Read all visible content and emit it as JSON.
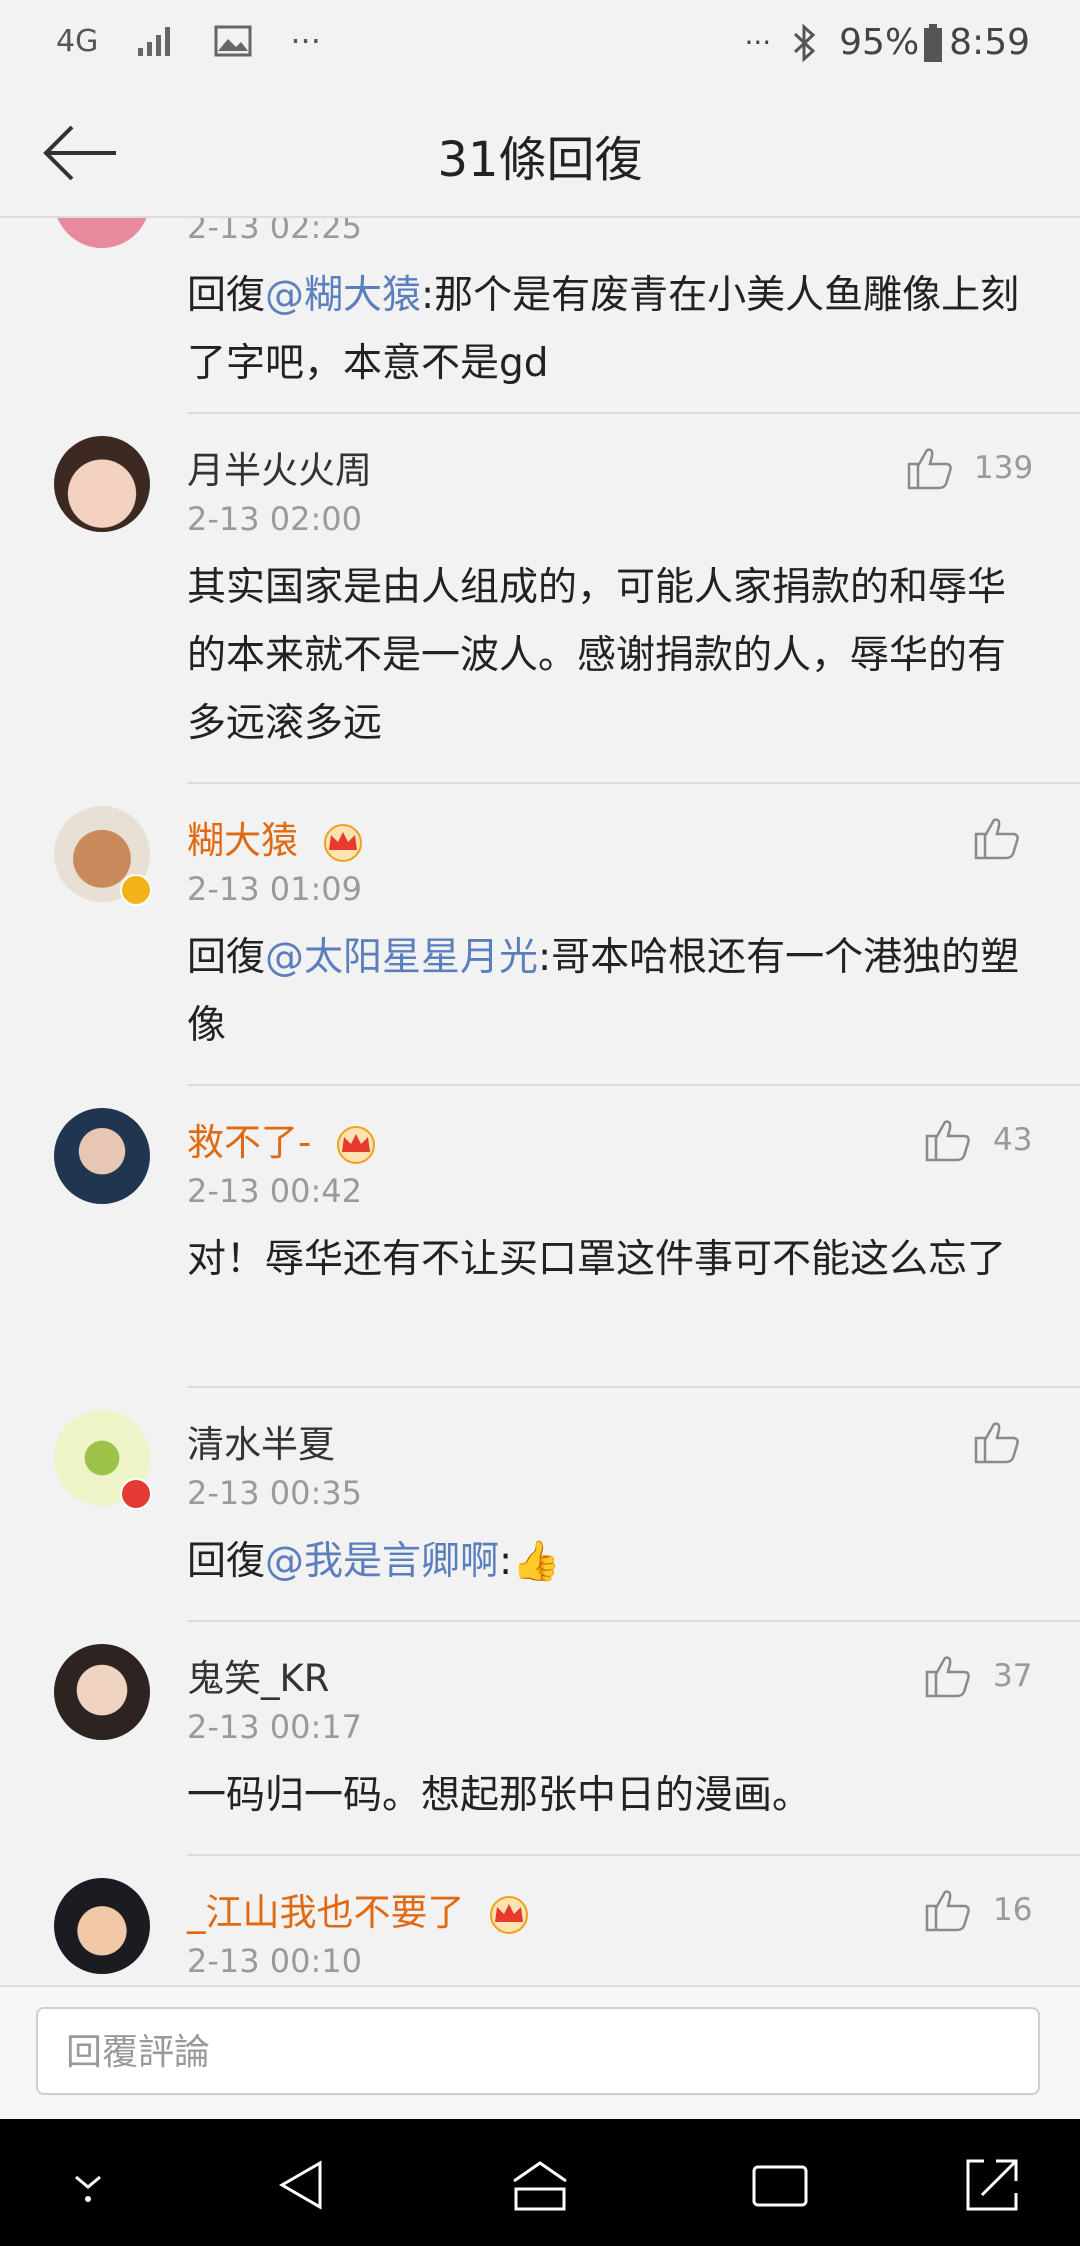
{
  "status": {
    "network": "4G",
    "more": "···",
    "dots_right": "···",
    "battery": "95%",
    "time": "8:59"
  },
  "header": {
    "title": "31條回復"
  },
  "comments": [
    {
      "name": "",
      "time": "2-13 02:25",
      "prefix": "回復",
      "mention": "@糊大猿",
      "text": ":那个是有废青在小美人鱼雕像上刻了字吧，本意不是gd",
      "likes": ""
    },
    {
      "name": "月半火火周",
      "time": "2-13 02:00",
      "prefix": "",
      "mention": "",
      "text": "其实国家是由人组成的，可能人家捐款的和辱华的本来就不是一波人。感谢捐款的人，辱华的有多远滚多远",
      "likes": "139"
    },
    {
      "name": "糊大猿",
      "time": "2-13 01:09",
      "prefix": "回復",
      "mention": "@太阳星星月光",
      "text": ":哥本哈根还有一个港独的塑像",
      "likes": ""
    },
    {
      "name": "救不了-",
      "time": "2-13 00:42",
      "prefix": "",
      "mention": "",
      "text": "对！辱华还有不让买口罩这件事可不能这么忘了",
      "likes": "43"
    },
    {
      "name": "清水半夏",
      "time": "2-13 00:35",
      "prefix": "回復",
      "mention": "@我是言卿啊",
      "text": ":👍",
      "likes": ""
    },
    {
      "name": "鬼笑_KR",
      "time": "2-13 00:17",
      "prefix": "",
      "mention": "",
      "text": "一码归一码。想起那张中日的漫画。",
      "likes": "37"
    },
    {
      "name": "_江山我也不要了",
      "time": "2-13 00:10",
      "prefix": "",
      "mention": "",
      "text": "",
      "likes": "16"
    }
  ],
  "input": {
    "placeholder": "回覆評論"
  },
  "colors": {
    "mention": "#5b7fbd",
    "vip_name": "#e06a12",
    "crown": "#f0a020"
  }
}
